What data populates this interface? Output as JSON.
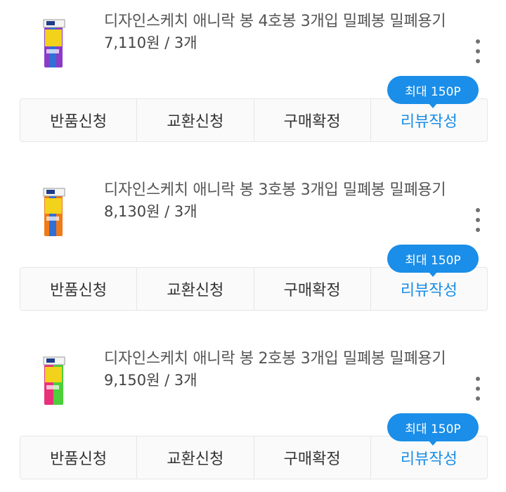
{
  "orders": [
    {
      "name": "디자인스케치 애니락 봉 4호봉 3개입 밀폐봉 밀폐용기",
      "price": "7,110원 / 3개",
      "badge": "최대 150P",
      "actions": {
        "return": "반품신청",
        "exchange": "교환신청",
        "confirm": "구매확정",
        "review": "리뷰작성"
      },
      "accent_color": "#8a3cc8",
      "accent_color2": "#f2d21a",
      "accent_color3": "#2f6fd6"
    },
    {
      "name": "디자인스케치 애니락 봉 3호봉 3개입 밀폐봉 밀폐용기",
      "price": "8,130원 / 3개",
      "badge": "최대 150P",
      "actions": {
        "return": "반품신청",
        "exchange": "교환신청",
        "confirm": "구매확정",
        "review": "리뷰작성"
      },
      "accent_color": "#f07a1a",
      "accent_color2": "#f2d21a",
      "accent_color3": "#2f6fd6"
    },
    {
      "name": "디자인스케치 애니락 봉 2호봉 3개입 밀폐봉 밀폐용기",
      "price": "9,150원 / 3개",
      "badge": "최대 150P",
      "actions": {
        "return": "반품신청",
        "exchange": "교환신청",
        "confirm": "구매확정",
        "review": "리뷰작성"
      },
      "accent_color": "#e8317a",
      "accent_color2": "#f2d21a",
      "accent_color3": "#4ccf3a"
    }
  ],
  "icons": {
    "more": "more-vertical-icon"
  },
  "colors": {
    "primary": "#1a8ee8"
  }
}
